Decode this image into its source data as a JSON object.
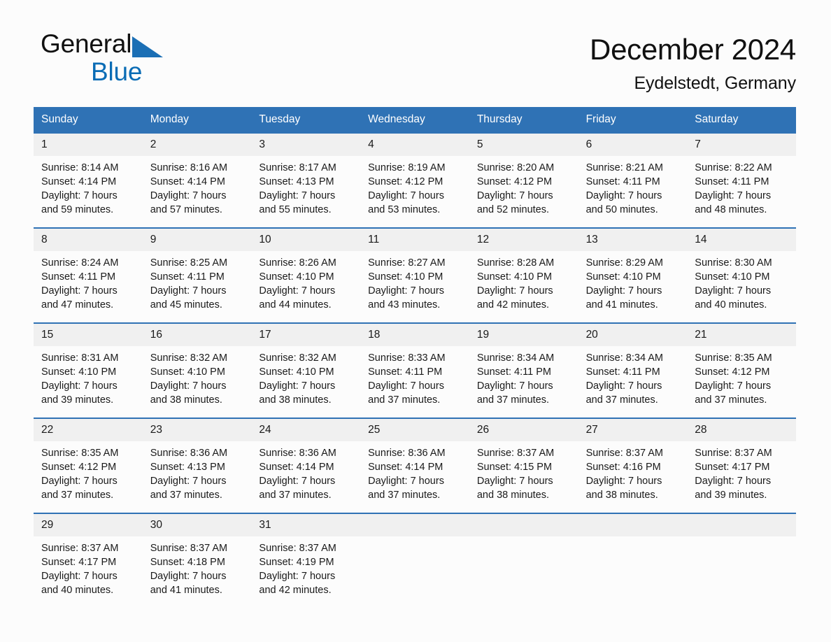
{
  "brand": {
    "name_dark": "General",
    "name_blue": "Blue",
    "triangle_color": "#1b6fb5",
    "blue_color": "#0a6cb5"
  },
  "header": {
    "title": "December 2024",
    "location": "Eydelstedt, Germany"
  },
  "theme": {
    "header_blue": "#2f72b5",
    "daynum_gray": "#f0f0f0",
    "page_background": "#fcfcfc",
    "text_color": "#1a1a1a"
  },
  "weekdays": [
    "Sunday",
    "Monday",
    "Tuesday",
    "Wednesday",
    "Thursday",
    "Friday",
    "Saturday"
  ],
  "weeks": [
    {
      "days": [
        {
          "num": "1",
          "sunrise": "Sunrise: 8:14 AM",
          "sunset": "Sunset: 4:14 PM",
          "daylight1": "Daylight: 7 hours",
          "daylight2": "and 59 minutes."
        },
        {
          "num": "2",
          "sunrise": "Sunrise: 8:16 AM",
          "sunset": "Sunset: 4:14 PM",
          "daylight1": "Daylight: 7 hours",
          "daylight2": "and 57 minutes."
        },
        {
          "num": "3",
          "sunrise": "Sunrise: 8:17 AM",
          "sunset": "Sunset: 4:13 PM",
          "daylight1": "Daylight: 7 hours",
          "daylight2": "and 55 minutes."
        },
        {
          "num": "4",
          "sunrise": "Sunrise: 8:19 AM",
          "sunset": "Sunset: 4:12 PM",
          "daylight1": "Daylight: 7 hours",
          "daylight2": "and 53 minutes."
        },
        {
          "num": "5",
          "sunrise": "Sunrise: 8:20 AM",
          "sunset": "Sunset: 4:12 PM",
          "daylight1": "Daylight: 7 hours",
          "daylight2": "and 52 minutes."
        },
        {
          "num": "6",
          "sunrise": "Sunrise: 8:21 AM",
          "sunset": "Sunset: 4:11 PM",
          "daylight1": "Daylight: 7 hours",
          "daylight2": "and 50 minutes."
        },
        {
          "num": "7",
          "sunrise": "Sunrise: 8:22 AM",
          "sunset": "Sunset: 4:11 PM",
          "daylight1": "Daylight: 7 hours",
          "daylight2": "and 48 minutes."
        }
      ]
    },
    {
      "days": [
        {
          "num": "8",
          "sunrise": "Sunrise: 8:24 AM",
          "sunset": "Sunset: 4:11 PM",
          "daylight1": "Daylight: 7 hours",
          "daylight2": "and 47 minutes."
        },
        {
          "num": "9",
          "sunrise": "Sunrise: 8:25 AM",
          "sunset": "Sunset: 4:11 PM",
          "daylight1": "Daylight: 7 hours",
          "daylight2": "and 45 minutes."
        },
        {
          "num": "10",
          "sunrise": "Sunrise: 8:26 AM",
          "sunset": "Sunset: 4:10 PM",
          "daylight1": "Daylight: 7 hours",
          "daylight2": "and 44 minutes."
        },
        {
          "num": "11",
          "sunrise": "Sunrise: 8:27 AM",
          "sunset": "Sunset: 4:10 PM",
          "daylight1": "Daylight: 7 hours",
          "daylight2": "and 43 minutes."
        },
        {
          "num": "12",
          "sunrise": "Sunrise: 8:28 AM",
          "sunset": "Sunset: 4:10 PM",
          "daylight1": "Daylight: 7 hours",
          "daylight2": "and 42 minutes."
        },
        {
          "num": "13",
          "sunrise": "Sunrise: 8:29 AM",
          "sunset": "Sunset: 4:10 PM",
          "daylight1": "Daylight: 7 hours",
          "daylight2": "and 41 minutes."
        },
        {
          "num": "14",
          "sunrise": "Sunrise: 8:30 AM",
          "sunset": "Sunset: 4:10 PM",
          "daylight1": "Daylight: 7 hours",
          "daylight2": "and 40 minutes."
        }
      ]
    },
    {
      "days": [
        {
          "num": "15",
          "sunrise": "Sunrise: 8:31 AM",
          "sunset": "Sunset: 4:10 PM",
          "daylight1": "Daylight: 7 hours",
          "daylight2": "and 39 minutes."
        },
        {
          "num": "16",
          "sunrise": "Sunrise: 8:32 AM",
          "sunset": "Sunset: 4:10 PM",
          "daylight1": "Daylight: 7 hours",
          "daylight2": "and 38 minutes."
        },
        {
          "num": "17",
          "sunrise": "Sunrise: 8:32 AM",
          "sunset": "Sunset: 4:10 PM",
          "daylight1": "Daylight: 7 hours",
          "daylight2": "and 38 minutes."
        },
        {
          "num": "18",
          "sunrise": "Sunrise: 8:33 AM",
          "sunset": "Sunset: 4:11 PM",
          "daylight1": "Daylight: 7 hours",
          "daylight2": "and 37 minutes."
        },
        {
          "num": "19",
          "sunrise": "Sunrise: 8:34 AM",
          "sunset": "Sunset: 4:11 PM",
          "daylight1": "Daylight: 7 hours",
          "daylight2": "and 37 minutes."
        },
        {
          "num": "20",
          "sunrise": "Sunrise: 8:34 AM",
          "sunset": "Sunset: 4:11 PM",
          "daylight1": "Daylight: 7 hours",
          "daylight2": "and 37 minutes."
        },
        {
          "num": "21",
          "sunrise": "Sunrise: 8:35 AM",
          "sunset": "Sunset: 4:12 PM",
          "daylight1": "Daylight: 7 hours",
          "daylight2": "and 37 minutes."
        }
      ]
    },
    {
      "days": [
        {
          "num": "22",
          "sunrise": "Sunrise: 8:35 AM",
          "sunset": "Sunset: 4:12 PM",
          "daylight1": "Daylight: 7 hours",
          "daylight2": "and 37 minutes."
        },
        {
          "num": "23",
          "sunrise": "Sunrise: 8:36 AM",
          "sunset": "Sunset: 4:13 PM",
          "daylight1": "Daylight: 7 hours",
          "daylight2": "and 37 minutes."
        },
        {
          "num": "24",
          "sunrise": "Sunrise: 8:36 AM",
          "sunset": "Sunset: 4:14 PM",
          "daylight1": "Daylight: 7 hours",
          "daylight2": "and 37 minutes."
        },
        {
          "num": "25",
          "sunrise": "Sunrise: 8:36 AM",
          "sunset": "Sunset: 4:14 PM",
          "daylight1": "Daylight: 7 hours",
          "daylight2": "and 37 minutes."
        },
        {
          "num": "26",
          "sunrise": "Sunrise: 8:37 AM",
          "sunset": "Sunset: 4:15 PM",
          "daylight1": "Daylight: 7 hours",
          "daylight2": "and 38 minutes."
        },
        {
          "num": "27",
          "sunrise": "Sunrise: 8:37 AM",
          "sunset": "Sunset: 4:16 PM",
          "daylight1": "Daylight: 7 hours",
          "daylight2": "and 38 minutes."
        },
        {
          "num": "28",
          "sunrise": "Sunrise: 8:37 AM",
          "sunset": "Sunset: 4:17 PM",
          "daylight1": "Daylight: 7 hours",
          "daylight2": "and 39 minutes."
        }
      ]
    },
    {
      "days": [
        {
          "num": "29",
          "sunrise": "Sunrise: 8:37 AM",
          "sunset": "Sunset: 4:17 PM",
          "daylight1": "Daylight: 7 hours",
          "daylight2": "and 40 minutes."
        },
        {
          "num": "30",
          "sunrise": "Sunrise: 8:37 AM",
          "sunset": "Sunset: 4:18 PM",
          "daylight1": "Daylight: 7 hours",
          "daylight2": "and 41 minutes."
        },
        {
          "num": "31",
          "sunrise": "Sunrise: 8:37 AM",
          "sunset": "Sunset: 4:19 PM",
          "daylight1": "Daylight: 7 hours",
          "daylight2": "and 42 minutes."
        },
        {
          "num": "",
          "sunrise": "",
          "sunset": "",
          "daylight1": "",
          "daylight2": ""
        },
        {
          "num": "",
          "sunrise": "",
          "sunset": "",
          "daylight1": "",
          "daylight2": ""
        },
        {
          "num": "",
          "sunrise": "",
          "sunset": "",
          "daylight1": "",
          "daylight2": ""
        },
        {
          "num": "",
          "sunrise": "",
          "sunset": "",
          "daylight1": "",
          "daylight2": ""
        }
      ]
    }
  ]
}
